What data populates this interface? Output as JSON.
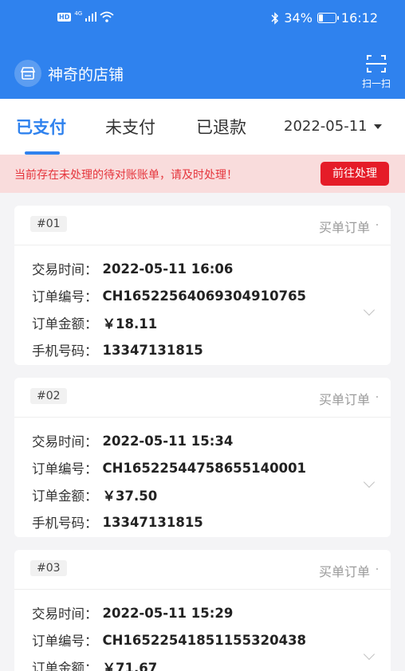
{
  "status_bar": {
    "hd": "HD",
    "network": "4G",
    "battery_text": "34%",
    "battery_level": 0.34,
    "time": "16:12"
  },
  "store": {
    "name": "神奇的店铺"
  },
  "scan": {
    "label": "扫一扫"
  },
  "tabs": [
    "已支付",
    "未支付",
    "已退款"
  ],
  "active_tab": 0,
  "date_filter": "2022-05-11",
  "alert": {
    "message": "当前存在未处理的待对账账单，请及时处理！",
    "button": "前往处理"
  },
  "orders": [
    {
      "no": "#01",
      "type": "买单订单",
      "fields": [
        {
          "label": "交易时间：",
          "value": "2022-05-11 16:06"
        },
        {
          "label": "订单编号：",
          "value": "CH16522564069304910765"
        },
        {
          "label": "订单金额：",
          "value": "￥18.11"
        },
        {
          "label": "手机号码：",
          "value": "13347131815"
        }
      ]
    },
    {
      "no": "#02",
      "type": "买单订单",
      "fields": [
        {
          "label": "交易时间：",
          "value": "2022-05-11 15:34"
        },
        {
          "label": "订单编号：",
          "value": "CH16522544758655140001"
        },
        {
          "label": "订单金额：",
          "value": "￥37.50"
        },
        {
          "label": "手机号码：",
          "value": "13347131815"
        }
      ]
    },
    {
      "no": "#03",
      "type": "买单订单",
      "fields": [
        {
          "label": "交易时间：",
          "value": "2022-05-11 15:29"
        },
        {
          "label": "订单编号：",
          "value": "CH16522541851155320438"
        },
        {
          "label": "订单金额：",
          "value": "￥71.67"
        }
      ]
    }
  ],
  "colors": {
    "primary": "#2f82ee",
    "alert_bg": "#f9dcdc",
    "alert_text": "#e5353c",
    "alert_button": "#e51c28"
  }
}
